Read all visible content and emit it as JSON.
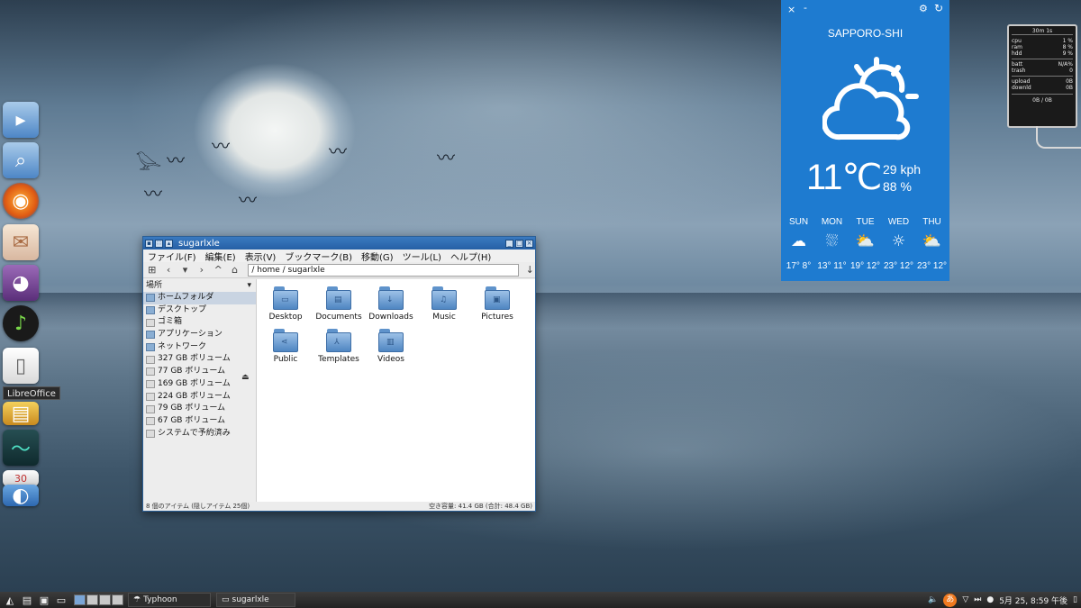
{
  "dock": {
    "tooltip": "LibreOffice",
    "items": [
      {
        "name": "files"
      },
      {
        "name": "search"
      },
      {
        "name": "firefox"
      },
      {
        "name": "mail"
      },
      {
        "name": "pidgin"
      },
      {
        "name": "music"
      },
      {
        "name": "libreoffice"
      },
      {
        "name": "office-apps"
      },
      {
        "name": "system-monitor"
      },
      {
        "name": "calendar"
      },
      {
        "name": "installer"
      }
    ]
  },
  "file_manager": {
    "title": "sugarlxle",
    "menu": [
      "ファイル(F)",
      "編集(E)",
      "表示(V)",
      "ブックマーク(B)",
      "移動(G)",
      "ツール(L)",
      "ヘルプ(H)"
    ],
    "path": "/ home / sugarlxle",
    "sidebar_header": "場所",
    "places": [
      {
        "label": "ホームフォルダ",
        "selected": true
      },
      {
        "label": "デスクトップ"
      },
      {
        "label": "ゴミ箱"
      },
      {
        "label": "アプリケーション"
      },
      {
        "label": "ネットワーク"
      },
      {
        "label": "327 GB ボリューム"
      },
      {
        "label": "77 GB ボリューム"
      },
      {
        "label": "169 GB ボリューム"
      },
      {
        "label": "224 GB ボリューム"
      },
      {
        "label": "79 GB ボリューム"
      },
      {
        "label": "67 GB ボリューム"
      },
      {
        "label": "システムで予約済み"
      }
    ],
    "folders": [
      "Desktop",
      "Documents",
      "Downloads",
      "Music",
      "Pictures",
      "Public",
      "Templates",
      "Videos"
    ],
    "status_left": "8 個のアイテム (隠しアイテム 25個)",
    "status_right": "空き容量: 41.4 GB (合計: 48.4 GB)"
  },
  "weather": {
    "city": "SAPPORO-SHI",
    "temperature": "11℃",
    "wind": "29 kph",
    "humidity": "88 %",
    "forecast": [
      {
        "day": "SUN",
        "range": "17° 8°"
      },
      {
        "day": "MON",
        "range": "13° 11°"
      },
      {
        "day": "TUE",
        "range": "19° 12°"
      },
      {
        "day": "WED",
        "range": "23° 12°"
      },
      {
        "day": "THU",
        "range": "23° 12°"
      }
    ],
    "colors": {
      "background": "#1e7bd0"
    }
  },
  "sysmon": {
    "title": "30m 1s",
    "rows": [
      {
        "k": "cpu",
        "v": "1 %"
      },
      {
        "k": "ram",
        "v": "8 %"
      },
      {
        "k": "hdd",
        "v": "9 %"
      }
    ],
    "rows2": [
      {
        "k": "batt",
        "v": "N/A%"
      },
      {
        "k": "trash",
        "v": "0"
      }
    ],
    "rows3": [
      {
        "k": "upload",
        "v": "0B"
      },
      {
        "k": "downld",
        "v": "0B"
      }
    ],
    "total": "0B  /  0B"
  },
  "taskbar": {
    "tasks": [
      {
        "label": "Typhoon"
      },
      {
        "label": "sugarlxle"
      }
    ],
    "clock": "5月 25, 8:59 午後",
    "ime": "あ"
  }
}
